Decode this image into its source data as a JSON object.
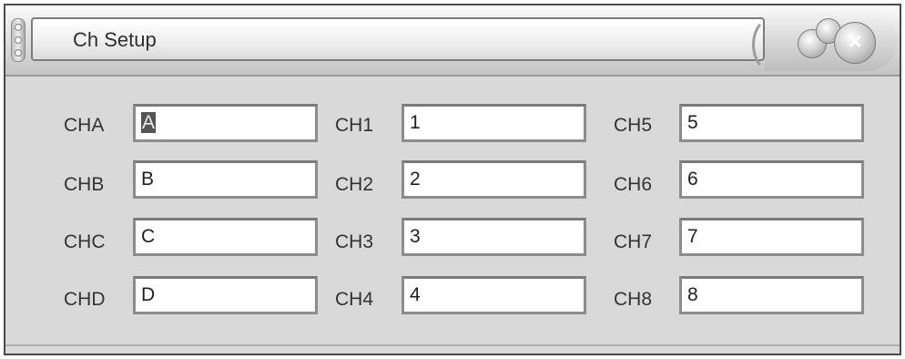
{
  "window": {
    "title": "Ch Setup"
  },
  "channels": [
    {
      "label": "CHA",
      "value": "A",
      "selected": true
    },
    {
      "label": "CHB",
      "value": "B"
    },
    {
      "label": "CHC",
      "value": "C"
    },
    {
      "label": "CHD",
      "value": "D"
    },
    {
      "label": "CH1",
      "value": "1"
    },
    {
      "label": "CH2",
      "value": "2"
    },
    {
      "label": "CH3",
      "value": "3"
    },
    {
      "label": "CH4",
      "value": "4"
    },
    {
      "label": "CH5",
      "value": "5"
    },
    {
      "label": "CH6",
      "value": "6"
    },
    {
      "label": "CH7",
      "value": "7"
    },
    {
      "label": "CH8",
      "value": "8"
    }
  ],
  "icons": {
    "close": "close-icon",
    "grip": "grip-icon",
    "window_buttons": "window-buttons-icon"
  }
}
